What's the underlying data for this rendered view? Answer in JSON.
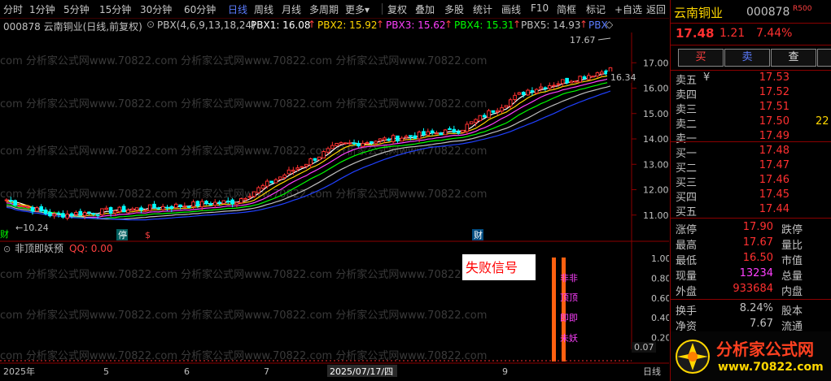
{
  "toolbar": {
    "items": [
      "分时",
      "1分钟",
      "5分钟",
      "15分钟",
      "30分钟",
      "60分钟",
      "日线",
      "周线",
      "月线",
      "多周期",
      "更多",
      "复权",
      "叠加",
      "多股",
      "统计",
      "画线",
      "F10",
      "简框",
      "标记",
      "+自选",
      "返回"
    ],
    "active": "日线",
    "more_arrow": "▾"
  },
  "infobar": {
    "code_name": "000878 云南铜业(日线,前复权)",
    "pbx_params": "PBX(4,6,9,13,18,24)",
    "pbx1": "PBX1: 16.08",
    "pbx2": "PBX2: 15.92",
    "pbx3": "PBX3: 15.62",
    "pbx4": "PBX4: 15.31",
    "pbx5": "PBX5: 14.93",
    "pbx6": "PBX",
    "arrow": "↑",
    "dropdown_icon": "⊙",
    "diamond": "◇"
  },
  "chart": {
    "price_labels": [
      "17.00",
      "16.00",
      "15.00",
      "14.00",
      "13.00",
      "12.00",
      "11.00"
    ],
    "max_label": "17.67",
    "min_label": "10.24",
    "current_label": "16.34",
    "events": [
      "财",
      "停",
      "$",
      "财"
    ],
    "watermark": "com 分析家公式网www.70822.com 分析家公式网www.70822.com 分析家公式网www.70822.com",
    "indicator_name": "非顶即妖预",
    "indicator_qq": "QQ: 0.00",
    "fail_label": "失败信号",
    "signal_chars": [
      "非非",
      "顶顶",
      "即即",
      "未妖"
    ],
    "ind_labels": [
      "1.00",
      "0.80",
      "0.60",
      "0.40",
      "0.20"
    ],
    "ind_zero": "0.07",
    "date_labels": [
      "2025年",
      "5",
      "6",
      "7",
      "2025/07/17/四",
      "9"
    ],
    "period_tab": "日线"
  },
  "chart_data": {
    "type": "candlestick",
    "price_range": [
      10.0,
      18.0
    ],
    "high": 17.67,
    "low": 10.24,
    "last": 17.48,
    "ma_lines": [
      {
        "name": "PBX1",
        "value": 16.08,
        "color": "#ffffff"
      },
      {
        "name": "PBX2",
        "value": 15.92,
        "color": "#ffd700"
      },
      {
        "name": "PBX3",
        "value": 15.62,
        "color": "#ff40ff"
      },
      {
        "name": "PBX4",
        "value": 15.31,
        "color": "#00ff00"
      },
      {
        "name": "PBX5",
        "value": 14.93,
        "color": "#c0c0c0"
      }
    ]
  },
  "quote": {
    "name": "云南铜业",
    "code": "000878",
    "r500": "R500",
    "price": "17.48",
    "change": "1.21",
    "pct": "7.44%",
    "buy_btn": "买",
    "sell_btn": "卖",
    "query_btn": "查",
    "cancel_btn": "",
    "asks": [
      {
        "label": "卖五",
        "price": "17.53",
        "vol": ""
      },
      {
        "label": "卖四",
        "price": "17.52",
        "vol": ""
      },
      {
        "label": "卖三",
        "price": "17.51",
        "vol": ""
      },
      {
        "label": "卖二",
        "price": "17.50",
        "vol": "22"
      },
      {
        "label": "卖一",
        "price": "17.49",
        "vol": ""
      }
    ],
    "bids": [
      {
        "label": "买一",
        "price": "17.48",
        "vol": ""
      },
      {
        "label": "买二",
        "price": "17.47",
        "vol": ""
      },
      {
        "label": "买三",
        "price": "17.46",
        "vol": ""
      },
      {
        "label": "买四",
        "price": "17.45",
        "vol": ""
      },
      {
        "label": "买五",
        "price": "17.44",
        "vol": ""
      }
    ],
    "stats": [
      {
        "l": "涨停",
        "v": "17.90",
        "r": "跌停"
      },
      {
        "l": "最高",
        "v": "17.67",
        "r": "量比"
      },
      {
        "l": "最低",
        "v": "16.50",
        "r": "市值"
      },
      {
        "l": "现量",
        "v": "13234",
        "r": "总量"
      },
      {
        "l": "外盘",
        "v": "933684",
        "r": "内盘"
      },
      {
        "l": "换手",
        "v": "8.24%",
        "r": "股本"
      },
      {
        "l": "净资",
        "v": "7.67",
        "r": "流通"
      }
    ],
    "yen": "¥",
    "logo_text": "分析家公式网",
    "logo_url": "www.70822.com"
  }
}
